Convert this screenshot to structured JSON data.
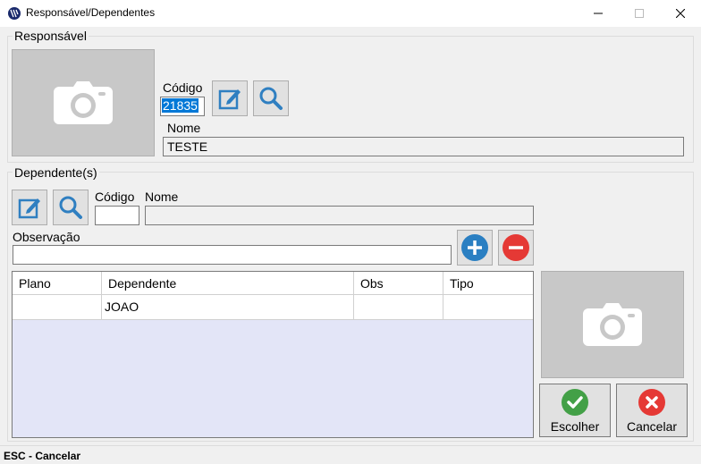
{
  "window": {
    "title": "Responsável/Dependentes",
    "app_icon": "app-logo-icon"
  },
  "responsavel": {
    "legend": "Responsável",
    "codigo_label": "Código",
    "codigo_value": "21835",
    "nome_label": "Nome",
    "nome_value": "TESTE",
    "photo_icon": "camera-icon"
  },
  "dependente": {
    "legend": "Dependente(s)",
    "codigo_label": "Código",
    "codigo_value": "",
    "nome_label": "Nome",
    "nome_value": "",
    "obs_label": "Observação",
    "obs_value": "",
    "photo_icon": "camera-icon"
  },
  "grid": {
    "columns": [
      "Plano",
      "Dependente",
      "Obs",
      "Tipo"
    ],
    "rows": [
      {
        "plano": "",
        "dependente": "JOAO",
        "obs": "",
        "tipo": ""
      }
    ]
  },
  "actions": {
    "escolher_label": "Escolher",
    "cancelar_label": "Cancelar"
  },
  "status": {
    "text": "ESC - Cancelar"
  },
  "colors": {
    "accent_blue": "#2f7fc1",
    "add_blue": "#2a7fc2",
    "remove_red": "#e53935",
    "confirm_green": "#43a047",
    "cancel_red": "#e53935",
    "grid_empty_bg": "#e3e5f7"
  }
}
